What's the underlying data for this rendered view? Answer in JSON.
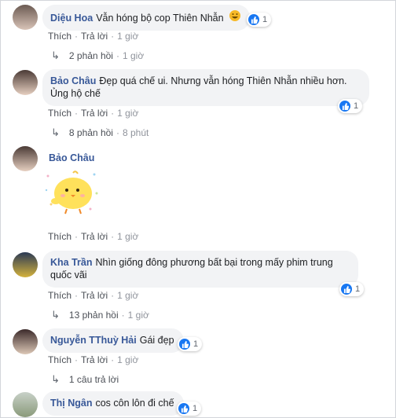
{
  "actions": {
    "like": "Thích",
    "reply": "Trả lời"
  },
  "comments": [
    {
      "name": "Diệu Hoa",
      "text": "Vẫn hóng bộ cop Thiên Nhẫn",
      "reaction_count": "1",
      "time": "1 giờ",
      "replies": "2 phản hồi",
      "replies_time": "1 giờ"
    },
    {
      "name": "Bảo Châu",
      "text": "Đẹp quá chế ui. Nhưng vẫn hóng Thiên Nhẫn nhiều hơn. Ủng hộ chế",
      "reaction_count": "1",
      "time": "1 giờ",
      "replies": "8 phản hồi",
      "replies_time": "8 phút"
    },
    {
      "name": "Bảo Châu",
      "text": "",
      "reaction_count": "",
      "time": "1 giờ",
      "replies": "",
      "replies_time": ""
    },
    {
      "name": "Kha Trần",
      "text": "Nhìn giống đông phương bất bại trong mấy phim trung quốc vãi",
      "reaction_count": "1",
      "time": "1 giờ",
      "replies": "13 phản hồi",
      "replies_time": "1 giờ"
    },
    {
      "name": "Nguyễn TThuỳ Hải",
      "text": "Gái đẹp",
      "reaction_count": "1",
      "time": "1 giờ",
      "replies": "1 câu trả lời",
      "replies_time": ""
    },
    {
      "name": "Thị Ngân",
      "text": "cos côn lôn đi chế",
      "reaction_count": "1",
      "time": "",
      "replies": "",
      "replies_time": ""
    }
  ],
  "colors": {
    "name": "#385898",
    "bubble": "#f2f3f5",
    "like": "#1877f2",
    "haha": "#f7b928"
  },
  "icons": [
    "like-icon",
    "haha-emoji-icon",
    "reply-arrow-icon",
    "chick-sticker"
  ]
}
